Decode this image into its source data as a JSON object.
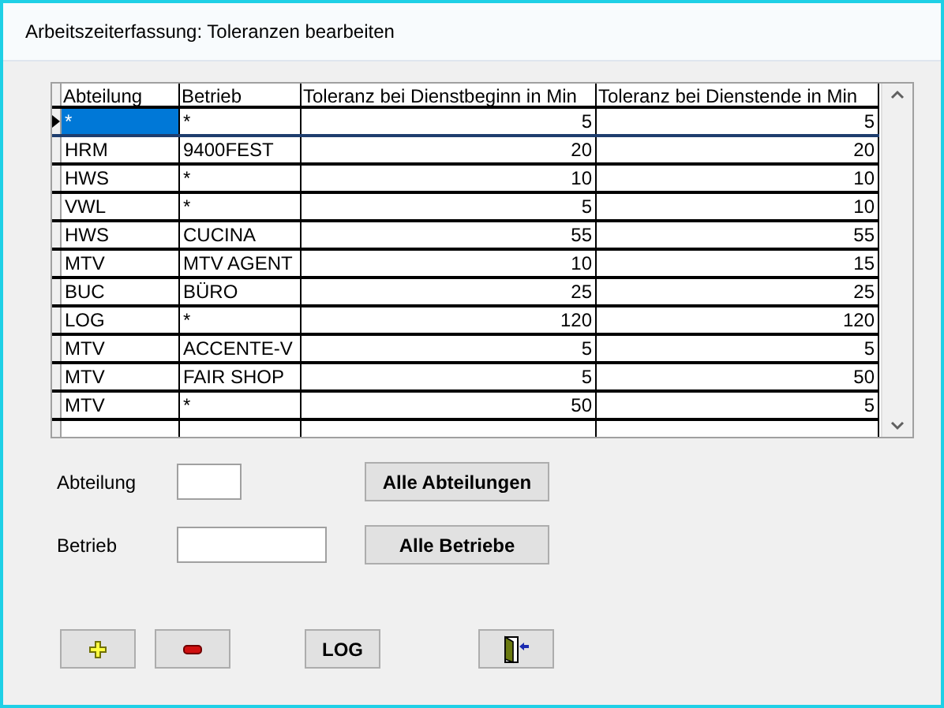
{
  "window": {
    "title": "Arbeitszeiterfassung: Toleranzen bearbeiten"
  },
  "table": {
    "columns": [
      "Abteilung",
      "Betrieb",
      "Toleranz bei Dienstbeginn in Min",
      "Toleranz bei Dienstende in Min"
    ],
    "rows": [
      {
        "cells": [
          "*",
          "*",
          "5",
          "5"
        ],
        "selected": true
      },
      {
        "cells": [
          "HRM",
          "9400FEST",
          "20",
          "20"
        ],
        "selected": false
      },
      {
        "cells": [
          "HWS",
          "*",
          "10",
          "10"
        ],
        "selected": false
      },
      {
        "cells": [
          "VWL",
          "*",
          "5",
          "10"
        ],
        "selected": false
      },
      {
        "cells": [
          "HWS",
          "CUCINA",
          "55",
          "55"
        ],
        "selected": false
      },
      {
        "cells": [
          "MTV",
          "MTV AGENT",
          "10",
          "15"
        ],
        "selected": false
      },
      {
        "cells": [
          "BUC",
          "BÜRO",
          "25",
          "25"
        ],
        "selected": false
      },
      {
        "cells": [
          "LOG",
          "*",
          "120",
          "120"
        ],
        "selected": false
      },
      {
        "cells": [
          "MTV",
          "ACCENTE-V",
          "5",
          "5"
        ],
        "selected": false
      },
      {
        "cells": [
          "MTV",
          "FAIR SHOP",
          "5",
          "50"
        ],
        "selected": false
      },
      {
        "cells": [
          "MTV",
          "*",
          "50",
          "5"
        ],
        "selected": false
      }
    ]
  },
  "filters": [
    {
      "label": "Abteilung",
      "button": "Alle Abteilungen",
      "kind": "short"
    },
    {
      "label": "Betrieb",
      "button": "Alle Betriebe",
      "kind": "long"
    }
  ],
  "actions": [
    {
      "kind": "add"
    },
    {
      "kind": "remove"
    },
    {
      "kind": "text",
      "label": "LOG"
    },
    {
      "kind": "exit"
    }
  ]
}
